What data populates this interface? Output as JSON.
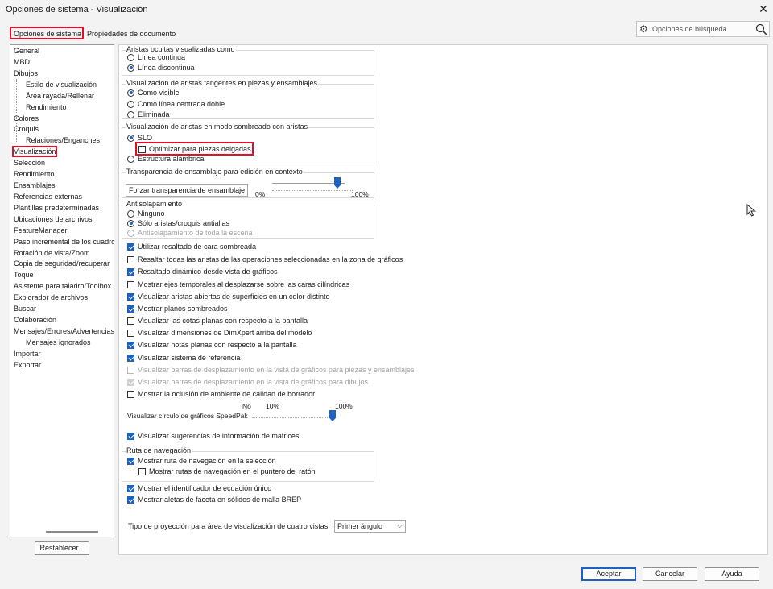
{
  "window": {
    "title": "Opciones de sistema - Visualización",
    "close_glyph": "✕"
  },
  "tabs": [
    {
      "label": "Opciones de sistema",
      "active": true
    },
    {
      "label": "Propiedades de documento",
      "active": false
    }
  ],
  "search": {
    "placeholder": "Opciones de búsqueda",
    "icon": "gear-icon",
    "search_icon": "magnifier-icon"
  },
  "tree": {
    "items": [
      {
        "label": "General",
        "level": 0
      },
      {
        "label": "MBD",
        "level": 0
      },
      {
        "label": "Dibujos",
        "level": 0
      },
      {
        "label": "Estilo de visualización",
        "level": 1
      },
      {
        "label": "Área rayada/Rellenar",
        "level": 1
      },
      {
        "label": "Rendimiento",
        "level": 1
      },
      {
        "label": "Colores",
        "level": 0
      },
      {
        "label": "Croquis",
        "level": 0
      },
      {
        "label": "Relaciones/Enganches",
        "level": 1
      },
      {
        "label": "Visualización",
        "level": 0,
        "selected": true
      },
      {
        "label": "Selección",
        "level": 0
      },
      {
        "label": "Rendimiento",
        "level": 0
      },
      {
        "label": "Ensamblajes",
        "level": 0
      },
      {
        "label": "Referencias externas",
        "level": 0
      },
      {
        "label": "Plantillas predeterminadas",
        "level": 0
      },
      {
        "label": "Ubicaciones de archivos",
        "level": 0
      },
      {
        "label": "FeatureManager",
        "level": 0
      },
      {
        "label": "Paso incremental de los cuadros",
        "level": 0
      },
      {
        "label": "Rotación de vista/Zoom",
        "level": 0
      },
      {
        "label": "Copia de seguridad/recuperar",
        "level": 0
      },
      {
        "label": "Toque",
        "level": 0
      },
      {
        "label": "Asistente para taladro/Toolbox",
        "level": 0
      },
      {
        "label": "Explorador de archivos",
        "level": 0
      },
      {
        "label": "Buscar",
        "level": 0
      },
      {
        "label": "Colaboración",
        "level": 0
      },
      {
        "label": "Mensajes/Errores/Advertencias",
        "level": 0
      },
      {
        "label": "Mensajes ignorados",
        "level": 1
      },
      {
        "label": "Importar",
        "level": 0
      },
      {
        "label": "Exportar",
        "level": 0
      }
    ]
  },
  "reset_label": "Restablecer...",
  "groups": {
    "hidden_edges": {
      "title": "Aristas ocultas visualizadas como",
      "options": [
        {
          "label": "Línea continua",
          "selected": false
        },
        {
          "label": "Línea discontinua",
          "selected": true
        }
      ]
    },
    "tangent_edges": {
      "title": "Visualización de aristas tangentes en piezas y ensamblajes",
      "options": [
        {
          "label": "Como visible",
          "selected": true
        },
        {
          "label": "Como línea centrada doble",
          "selected": false
        },
        {
          "label": "Eliminada",
          "selected": false
        }
      ]
    },
    "shaded_edges": {
      "title": "Visualización de aristas en modo sombreado con aristas",
      "option_hlr": "SLO",
      "thin_parts": "Optimizar para piezas delgadas",
      "wireframe": "Estructura alámbrica"
    },
    "transparency": {
      "title": "Transparencia de ensamblaje para edición en contexto",
      "combo_value": "Forzar transparencia de ensamblaje",
      "min_label": "0%",
      "max_label": "100%",
      "value": 0.9
    },
    "antialias": {
      "title": "Antisolapamiento",
      "options": [
        {
          "label": "Ninguno",
          "selected": false,
          "disabled": false
        },
        {
          "label": "Sólo aristas/croquis antialias",
          "selected": true,
          "disabled": false
        },
        {
          "label": "Antisolapamiento de toda la escena",
          "selected": false,
          "disabled": true
        }
      ]
    }
  },
  "checks": [
    {
      "label": "Utilizar resaltado de cara sombreada",
      "checked": true,
      "disabled": false
    },
    {
      "label": "Resaltar todas las aristas de las operaciones seleccionadas en la zona de gráficos",
      "checked": false,
      "disabled": false
    },
    {
      "label": "Resaltado dinámico desde vista de gráficos",
      "checked": true,
      "disabled": false
    },
    {
      "label": "Mostrar ejes temporales al desplazarse sobre las caras cilíndricas",
      "checked": false,
      "disabled": false
    },
    {
      "label": "Visualizar aristas abiertas de superficies en un color distinto",
      "checked": true,
      "disabled": false
    },
    {
      "label": "Mostrar planos sombreados",
      "checked": true,
      "disabled": false
    },
    {
      "label": "Visualizar las cotas planas con respecto a la pantalla",
      "checked": false,
      "disabled": false
    },
    {
      "label": "Visualizar dimensiones de DimXpert arriba del modelo",
      "checked": false,
      "disabled": false
    },
    {
      "label": "Visualizar notas planas con respecto a la pantalla",
      "checked": true,
      "disabled": false
    },
    {
      "label": "Visualizar sistema de referencia",
      "checked": true,
      "disabled": false
    },
    {
      "label": "Visualizar barras de desplazamiento en la vista de gráficos para piezas y ensamblajes",
      "checked": false,
      "disabled": true
    },
    {
      "label": "Visualizar barras de desplazamiento en la vista de gráficos para dibujos",
      "checked": true,
      "disabled": true
    },
    {
      "label": "Mostrar la oclusión de ambiente de calidad de borrador",
      "checked": false,
      "disabled": false
    }
  ],
  "speedpak": {
    "label": "Visualizar círculo de gráficos SpeedPak",
    "no_label": "No",
    "low_label": "10%",
    "high_label": "100%",
    "value": 1.0
  },
  "matrix_hints": {
    "label": "Visualizar sugerencias de información de matrices",
    "checked": true
  },
  "breadcrumbs": {
    "title": "Ruta de navegación",
    "show": {
      "label": "Mostrar ruta de navegación en la selección",
      "checked": true
    },
    "pointer": {
      "label": "Mostrar rutas de navegación en el puntero del ratón",
      "checked": false
    }
  },
  "equation_id": {
    "label": "Mostrar el identificador de ecuación único",
    "checked": true
  },
  "facet_fins": {
    "label": "Mostrar aletas de faceta en sólidos de malla BREP",
    "checked": true
  },
  "projection": {
    "label": "Tipo de proyección para área de visualización de cuatro vistas:",
    "value": "Primer ángulo"
  },
  "buttons": {
    "ok": "Aceptar",
    "cancel": "Cancelar",
    "help": "Ayuda"
  },
  "accent_color": "#1b62c4",
  "highlight_color": "#e0102a"
}
